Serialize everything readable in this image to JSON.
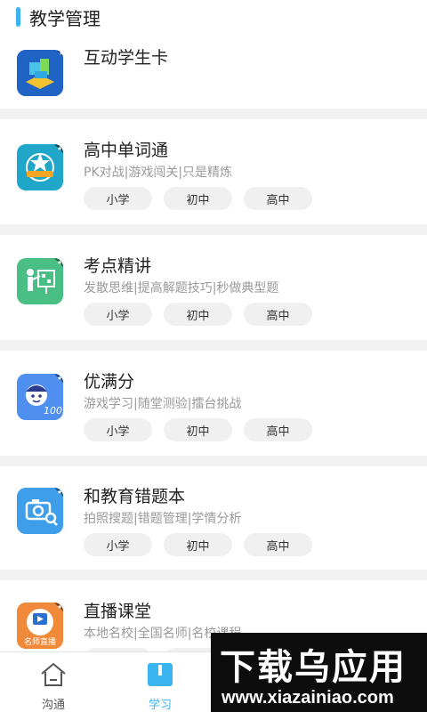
{
  "section": {
    "title": "教学管理"
  },
  "apps": [
    {
      "title": "互动学生卡",
      "icon_label": ""
    },
    {
      "title": "高中单词通",
      "desc": "PK对战|游戏闯关|只是精炼",
      "icon_label": ""
    },
    {
      "title": "考点精讲",
      "desc": "发散思维|提高解题技巧|秒做典型题"
    },
    {
      "title": "优满分",
      "desc": "游戏学习|随堂测验|擂台挑战"
    },
    {
      "title": "和教育错题本",
      "desc": "拍照搜题|错题管理|学情分析"
    },
    {
      "title": "直播课堂",
      "desc": "本地名校|全国名师|名校课程",
      "icon_label": "名师直播"
    }
  ],
  "tags": [
    "小学",
    "初中",
    "高中"
  ],
  "tabbar": {
    "tabs": [
      {
        "label": "沟通",
        "icon": "house-icon",
        "active": false
      },
      {
        "label": "学习",
        "icon": "book-icon",
        "active": true
      }
    ]
  },
  "watermark": {
    "title": "下载乌应用",
    "url": "www.xiazainiao.com"
  },
  "colors": {
    "accent": "#3cb4f0",
    "tag_bg": "#f0f0f0",
    "separator": "#f1f1f1"
  }
}
